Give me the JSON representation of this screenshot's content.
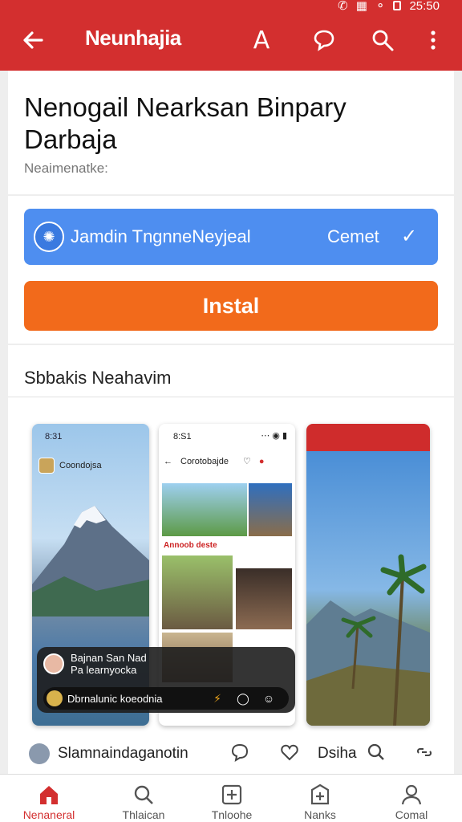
{
  "status_bar": {
    "time": "25:50"
  },
  "app_bar": {
    "title": "Neunhajia",
    "font_glyph": "A",
    "icons": [
      "back-arrow-icon",
      "font-size-icon",
      "chat-bubble-icon",
      "search-icon",
      "more-vert-icon"
    ]
  },
  "app": {
    "title": "Nenogail Nearksan Binpary Darbaja",
    "developer": "Neaimenatke:"
  },
  "connect": {
    "label": "Jamdin TngnneNeyjeal",
    "status": "Cemet"
  },
  "install_label": "Instal",
  "screenshots": {
    "title": "Sbbakis Neahavim",
    "shot1": {
      "time": "8:31",
      "pill_text": "Coondojsa"
    },
    "shot2": {
      "time": "8:S1",
      "header_text": "Corotobajde",
      "caption": "Annoob deste"
    },
    "overlay": {
      "name": "Bajnan San Nad",
      "subtitle": "Pa learnyocka",
      "message": "Dbrnalunic koeodnia"
    }
  },
  "social": {
    "name": "Slamnaindaganotin",
    "brand": "Dsiha"
  },
  "bottom_nav": [
    {
      "label": "Nenaneral",
      "icon": "home-icon",
      "active": true
    },
    {
      "label": "Thlaican",
      "icon": "search-icon",
      "active": false
    },
    {
      "label": "Tnloohe",
      "icon": "add-box-icon",
      "active": false
    },
    {
      "label": "Nanks",
      "icon": "add-tag-icon",
      "active": false
    },
    {
      "label": "Comal",
      "icon": "person-icon",
      "active": false
    }
  ],
  "colors": {
    "primary": "#d32f2f",
    "connect": "#4e8ef0",
    "install": "#f26a1b"
  }
}
